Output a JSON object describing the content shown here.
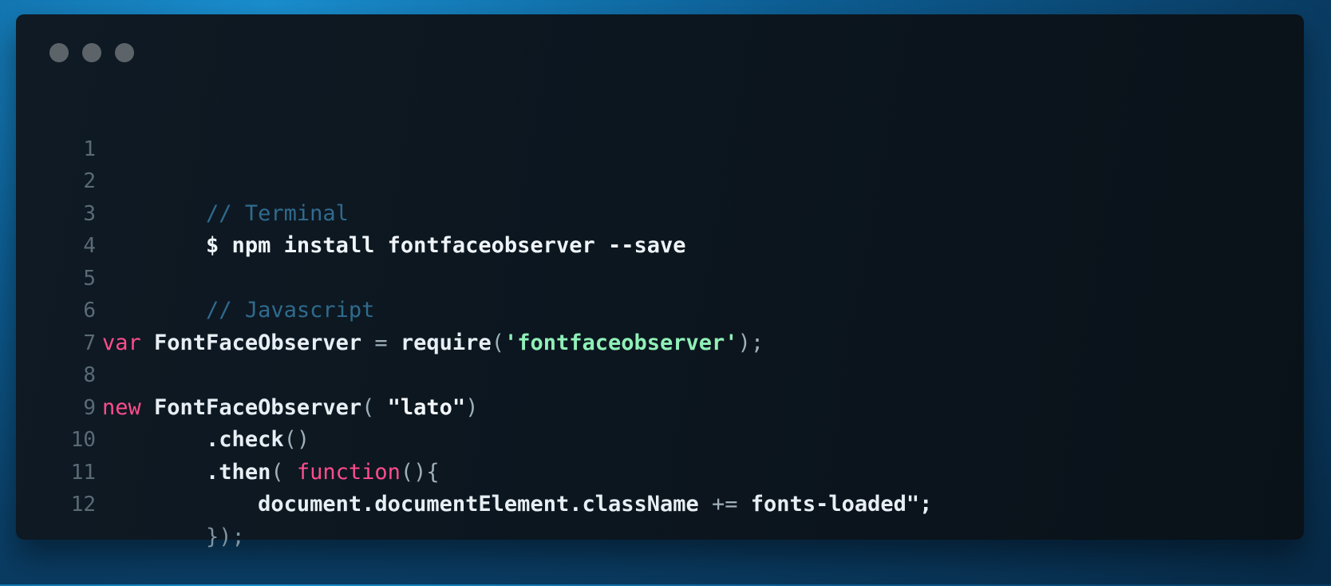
{
  "colors": {
    "background": "#0d5f95",
    "panel": "#0c161f",
    "comment": "#2f6b8e",
    "keyword": "#ff4d8d",
    "string": "#8ff0b8",
    "text": "#d7e3ea",
    "line_number": "#5a6b76"
  },
  "window_controls": [
    "circle-dot-icon",
    "circle-dot-icon",
    "circle-dot-icon"
  ],
  "code": {
    "line_numbers": [
      "1",
      "2",
      "3",
      "4",
      "5",
      "6",
      "7",
      "8",
      "9",
      "10",
      "11",
      "12"
    ],
    "lines": {
      "l1": {
        "comment": "// Terminal"
      },
      "l2": {
        "command": "$ npm install fontfaceobserver --save"
      },
      "l4": {
        "comment": "// Javascript"
      },
      "l6": {
        "keyword": "var",
        "name": " FontFaceObserver",
        "op": " = ",
        "func": "require",
        "open": "(",
        "string": "'fontfaceobserver'",
        "close": ");"
      },
      "l8": {
        "keyword": "new",
        "name": " FontFaceObserver",
        "open": "( ",
        "string": "\"lato\"",
        "close": ")"
      },
      "l9": {
        "indent": "        ",
        "method": ".check",
        "parens": "()"
      },
      "l10": {
        "indent": "        ",
        "method": ".then",
        "open": "( ",
        "keyword": "function",
        "parens": "(){"
      },
      "l11": {
        "indent": "            ",
        "text": "document.documentElement.className",
        "op": " += ",
        "value": "fonts-loaded\";"
      },
      "l12": {
        "indent": "        ",
        "text": "});"
      }
    }
  }
}
